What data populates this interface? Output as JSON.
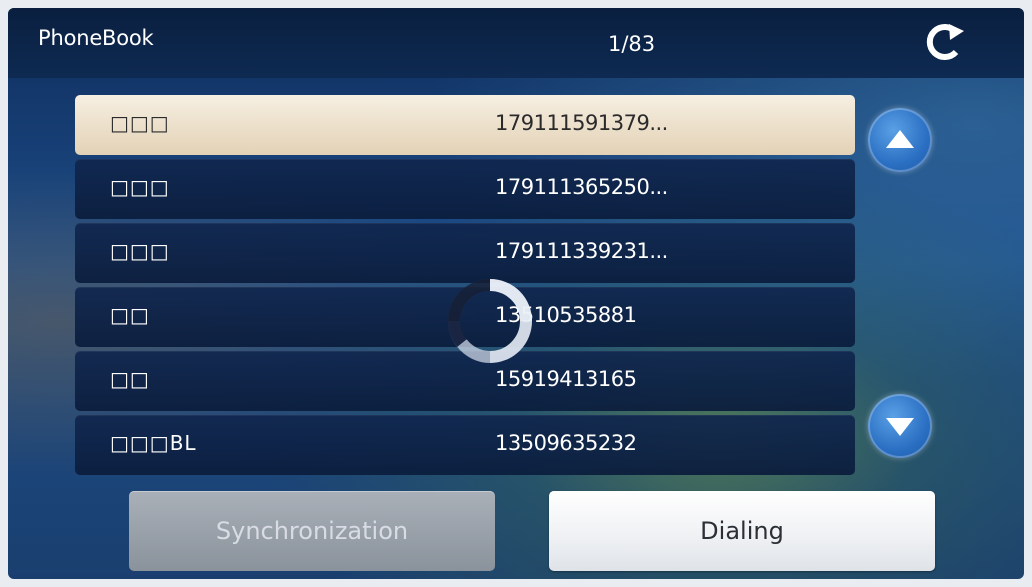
{
  "header": {
    "title": "PhoneBook",
    "page_indicator": "1/83"
  },
  "contacts": [
    {
      "name": "□□□",
      "number": "179111591379...",
      "selected": true
    },
    {
      "name": "□□□",
      "number": "179111365250...",
      "selected": false
    },
    {
      "name": "□□□",
      "number": "179111339231...",
      "selected": false
    },
    {
      "name": "□□",
      "number": "13510535881",
      "selected": false
    },
    {
      "name": "□□",
      "number": "15919413165",
      "selected": false
    },
    {
      "name": "□□□BL",
      "number": "13509635232",
      "selected": false
    }
  ],
  "buttons": {
    "synchronization": "Synchronization",
    "dialing": "Dialing"
  },
  "icons": {
    "back": "back-arrow-icon",
    "scroll_up": "chevron-up-icon",
    "scroll_down": "chevron-down-icon",
    "loading": "loading-spinner-icon"
  },
  "colors": {
    "accent": "#2a6fc2",
    "selected_row": "#efe3cf"
  }
}
